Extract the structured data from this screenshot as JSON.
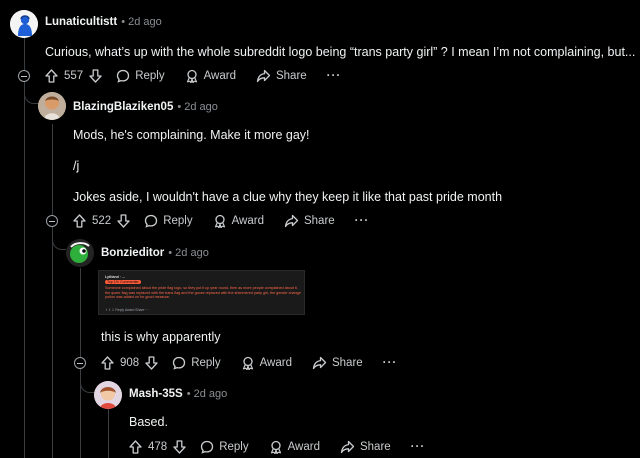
{
  "comments": [
    {
      "author": "Lunaticultistt",
      "time": "2d ago",
      "lines": [
        "Curious, what’s up with the whole subreddit logo being “trans party girl” ? I mean I’m not complaining, but..."
      ],
      "votes": "557"
    },
    {
      "author": "BlazingBlaziken05",
      "time": "2d ago",
      "lines": [
        "Mods, he's complaining. Make it more gay!",
        "/j",
        "Jokes aside, I wouldn't have a clue why they keep it like that past pride month"
      ],
      "votes": "522"
    },
    {
      "author": "Bonzieditor",
      "time": "2d ago",
      "lines": [
        "this is why apparently"
      ],
      "votes": "908"
    },
    {
      "author": "Mash-35S",
      "time": "2d ago",
      "lines": [
        "Based."
      ],
      "votes": "478"
    }
  ],
  "actions": {
    "reply": "Reply",
    "award": "Award",
    "share": "Share",
    "more": "···"
  },
  "embed": {
    "user": "Lyttland · ...",
    "flair": "Top 1% Commenter",
    "text": "Someone complained about the pride flag logo, so they put it up year round, then as more people complained about it, the queer flag was replaced with the trans flag and the goose replaced with the shimmered party girl, the gender change potion was added on for good measure.",
    "actions": "⇧  1  ⇩    Reply    Award    Share    ···"
  },
  "icons": [
    "upvote-icon",
    "downvote-icon",
    "reply-icon",
    "award-icon",
    "share-icon",
    "more-icon",
    "collapse-icon"
  ]
}
